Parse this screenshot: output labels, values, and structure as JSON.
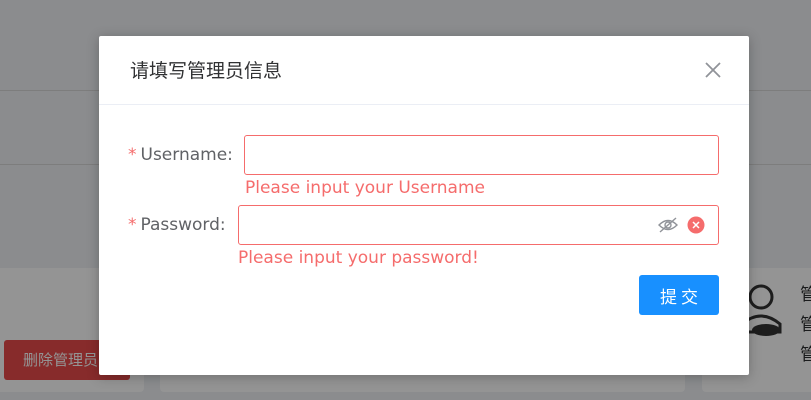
{
  "background": {
    "delete_admin_button": "删除管理员",
    "side_lines": [
      "管",
      "管",
      "管"
    ]
  },
  "dialog": {
    "title": "请填写管理员信息",
    "username": {
      "required_mark": "*",
      "label": "Username:",
      "value": "",
      "error": "Please input your Username"
    },
    "password": {
      "required_mark": "*",
      "label": "Password:",
      "value": "",
      "error": "Please input your password!"
    },
    "submit_label": "提交"
  },
  "colors": {
    "primary": "#1890ff",
    "error": "#f56c6c",
    "danger_button": "#e84b4b"
  }
}
